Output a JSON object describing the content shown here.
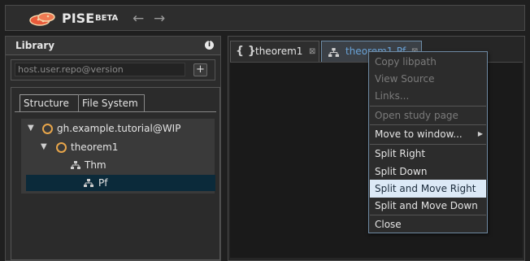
{
  "header": {
    "title": "PISE",
    "badge": "BETA",
    "back_symbol": "←",
    "forward_symbol": "→"
  },
  "library": {
    "title": "Library",
    "info_symbol": "i",
    "repo_placeholder": "host.user.repo@version",
    "add_symbol": "+",
    "tabs": [
      {
        "label": "Structure",
        "selected": true
      },
      {
        "label": "File System",
        "selected": false
      }
    ],
    "tree": [
      {
        "label": "gh.example.tutorial@WIP",
        "icon": "repo-circle-icon",
        "expanded": true
      },
      {
        "label": "theorem1",
        "icon": "module-circle-icon",
        "expanded": true
      },
      {
        "label": "Thm",
        "icon": "deduction-icon"
      },
      {
        "label": "Pf",
        "icon": "deduction-icon",
        "selected": true
      }
    ]
  },
  "editor": {
    "tabs": [
      {
        "label": "theorem1",
        "icon": "braces-icon",
        "close": "⊠"
      },
      {
        "label": "theorem1-Pf",
        "icon": "deduction-icon",
        "close": "⊠",
        "active": true
      }
    ]
  },
  "context_menu": {
    "items": [
      {
        "label": "Copy libpath",
        "enabled": false
      },
      {
        "label": "View Source",
        "enabled": false
      },
      {
        "label": "Links...",
        "enabled": false
      },
      {
        "label": "Open study page",
        "enabled": false
      },
      {
        "label": "Move to window...",
        "enabled": true,
        "submenu": true
      },
      {
        "label": "Split Right",
        "enabled": true
      },
      {
        "label": "Split Down",
        "enabled": true
      },
      {
        "label": "Split and Move Right",
        "enabled": true,
        "highlighted": true
      },
      {
        "label": "Split and Move Down",
        "enabled": true
      },
      {
        "label": "Close",
        "enabled": true
      }
    ],
    "submenu_symbol": "▶"
  },
  "colors": {
    "accent": "#6aa3d8",
    "tree_circle": "#e7a54a",
    "selected_row": "#0b2a3a",
    "menu_highlight": "#dce9f6"
  }
}
